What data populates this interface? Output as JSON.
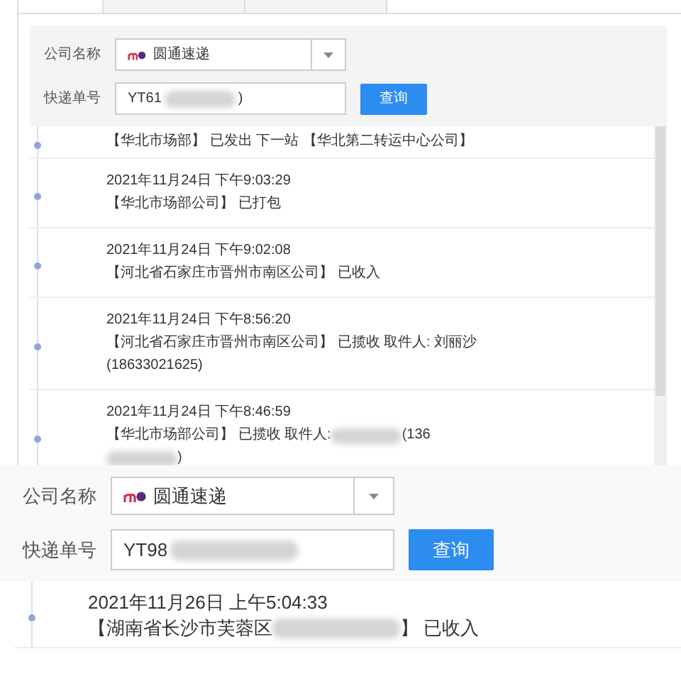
{
  "panels": [
    {
      "tabs": [
        {
          "selected": true
        },
        {
          "selected": false
        },
        {
          "selected": false
        }
      ],
      "company": {
        "label": "公司名称",
        "value": "圆通速递"
      },
      "number": {
        "label": "快递单号",
        "segments": [
          {
            "kind": "text",
            "text": "YT61"
          },
          {
            "kind": "redacted"
          },
          {
            "kind": "text",
            "text": ")"
          }
        ]
      },
      "button": "查询",
      "events": [
        {
          "text": "【华北市场部】 已发出 下一站 【华北第二转运中心公司】"
        },
        {
          "time": "2021年11月24日 下午9:03:29",
          "text": "【华北市场部公司】 已打包"
        },
        {
          "time": "2021年11月24日 下午9:02:08",
          "text": "【河北省石家庄市晋州市南区公司】 已收入"
        },
        {
          "time": "2021年11月24日 下午8:56:20",
          "text": "【河北省石家庄市晋州市南区公司】 已揽收 取件人: 刘丽沙(18633021625)"
        },
        {
          "time": "2021年11月24日 下午8:46:59",
          "segments": [
            {
              "kind": "text",
              "text": "【华北市场部公司】 已揽收 取件人:"
            },
            {
              "kind": "redacted"
            },
            {
              "kind": "text",
              "text": "(136"
            },
            {
              "kind": "redacted"
            },
            {
              "kind": "text",
              "text": ")"
            }
          ]
        }
      ]
    },
    {
      "company": {
        "label": "公司名称",
        "value": "圆通速递"
      },
      "number": {
        "label": "快递单号",
        "segments": [
          {
            "kind": "text",
            "text": "YT98"
          },
          {
            "kind": "redacted"
          }
        ]
      },
      "button": "查询",
      "events": [
        {
          "time": "2021年11月26日 上午5:04:33",
          "segments": [
            {
              "kind": "text",
              "text": "【湖南省长沙市芙蓉区"
            },
            {
              "kind": "redacted"
            },
            {
              "kind": "text",
              "text": "】 已收入"
            }
          ]
        }
      ]
    }
  ]
}
